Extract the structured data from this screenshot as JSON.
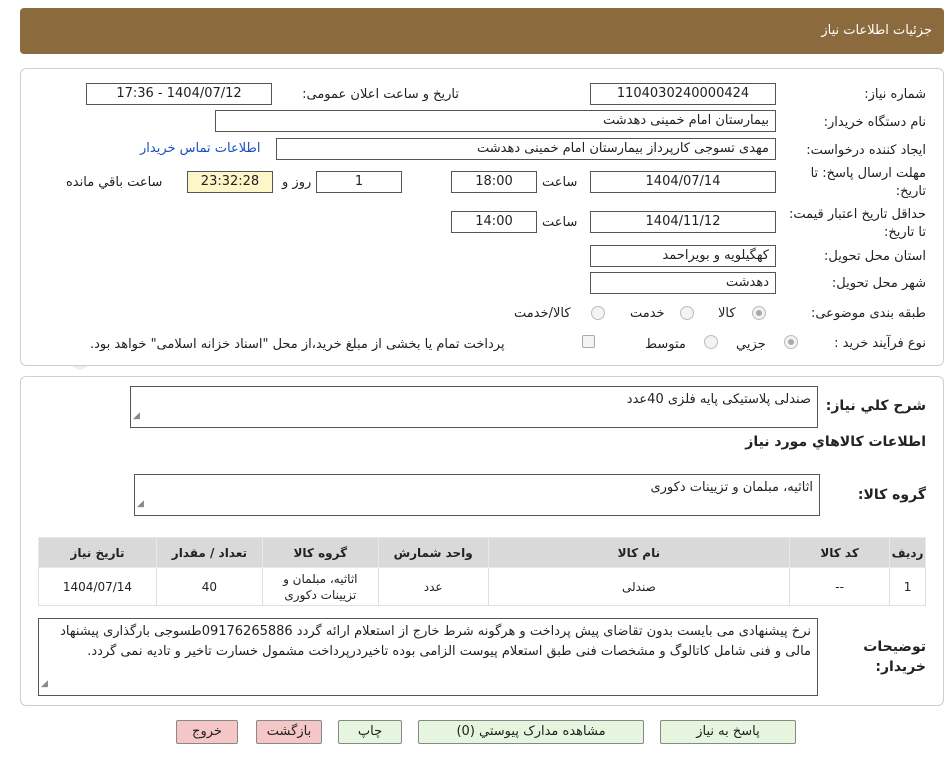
{
  "header": {
    "title": "جزئیات اطلاعات نیاز"
  },
  "watermark": {
    "text": "AriaTender.neT"
  },
  "form": {
    "need_number_label": "شماره نیاز:",
    "need_number": "1104030240000424",
    "announce_label": "تاریخ و ساعت اعلان عمومی:",
    "announce_value": "1404/07/12 - 17:36",
    "buyer_label": "نام دستگاه خریدار:",
    "buyer_value": "بیمارستان امام خمینی دهدشت",
    "creator_label": "ایجاد کننده درخواست:",
    "creator_value": "مهدی تسوجی کارپرداز بیمارستان امام خمینی دهدشت",
    "contact_link": "اطلاعات تماس خریدار",
    "deadline_label": "مهلت ارسال پاسخ: تا تاریخ:",
    "deadline_date": "1404/07/14",
    "time_label": "ساعت",
    "deadline_time": "18:00",
    "days_value": "1",
    "days_label": "روز و",
    "remaining_time": "23:32:28",
    "remaining_label": "ساعت باقي مانده",
    "validity_label": "حداقل تاریخ اعتبار قیمت: تا تاریخ:",
    "validity_date": "1404/11/12",
    "validity_time": "14:00",
    "province_label": "استان محل تحویل:",
    "province_value": "کهگیلویه و بویراحمد",
    "city_label": "شهر محل تحویل:",
    "city_value": "دهدشت",
    "category_label": "طبقه بندی موضوعی:",
    "category_options": [
      "کالا",
      "خدمت",
      "کالا/خدمت"
    ],
    "category_selected": "کالا",
    "process_label": "نوع فرآیند خرید :",
    "process_options": [
      "جزیي",
      "متوسط"
    ],
    "process_selected": "جزیي",
    "payment_note": "پرداخت تمام یا بخشی از مبلغ خرید،از محل \"اسناد خزانه اسلامی\" خواهد بود."
  },
  "summary": {
    "desc_label": "شرح كلي نياز:",
    "desc_value": "صندلی پلاستیکی پایه فلزی 40عدد",
    "goods_info_title": "اطلاعات كالاهاي مورد نياز",
    "group_label": "گروه کالا:",
    "group_value": "اثاثیه، مبلمان و تزیینات دکوری"
  },
  "table": {
    "headers": [
      "ردیف",
      "کد کالا",
      "نام کالا",
      "واحد شمارش",
      "گروه کالا",
      "تعداد / مقدار",
      "تاریخ نیاز"
    ],
    "rows": [
      [
        "1",
        "--",
        "صندلی",
        "عدد",
        "اثاثیه، مبلمان و تزیینات دکوری",
        "40",
        "1404/07/14"
      ]
    ]
  },
  "notes": {
    "label": "توضیحات خریدار:",
    "text": "نرخ پیشنهادی می بایست بدون تقاضای پیش پرداخت و هرگونه شرط خارج از استعلام ارائه گردد 09176265886طسوجی بارگذاری پیشنهاد مالی و فنی شامل کاتالوگ و مشخصات فنی طبق استعلام پیوست الزامی بوده تاخیردرپرداخت مشمول خسارت تاخیر و تادیه نمی گردد."
  },
  "buttons": {
    "reply": "پاسخ به نیاز",
    "attachments": "مشاهده مدارک پیوستي (0)",
    "print": "چاپ",
    "back": "بازگشت",
    "exit": "خروج"
  },
  "colors": {
    "header_bg": "#8b6a3e",
    "green_btn": "#e6f5dd",
    "pink_btn": "#f4c6c6",
    "link": "#1a4fbf"
  }
}
